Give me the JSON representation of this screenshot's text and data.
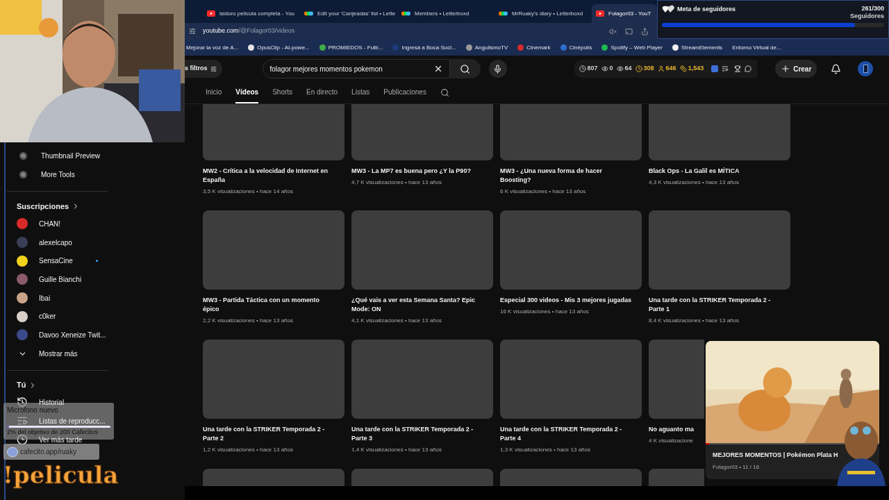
{
  "browser": {
    "tabs": [
      {
        "title": "isidoro pelicula completa - You",
        "kind": "youtube",
        "selected": false
      },
      {
        "title": "Edit your 'Canjeadas' list • Lette",
        "kind": "letterboxd",
        "selected": false
      },
      {
        "title": "Members • Letterboxd",
        "kind": "letterboxd",
        "selected": false
      },
      {
        "title": "MrRuaky's diary • Letterboxd",
        "kind": "letterboxd",
        "selected": false
      },
      {
        "title": "Folagor03 - YouT",
        "kind": "youtube",
        "selected": true
      }
    ],
    "url": {
      "host": "youtube.com",
      "path": "/@Folagor03/videos"
    },
    "bookmarks": [
      {
        "label": "Mejorar la voz de A..."
      },
      {
        "label": "OpusClip - AI-powe...",
        "color": "#e5e5e5"
      },
      {
        "label": "PROMIEDOS - Futb...",
        "color": "#3fae49"
      },
      {
        "label": "Ingresá a Boca Soci...",
        "color": "#1d3b7a"
      },
      {
        "label": "AngulismoTV",
        "color": "#9a9a9a"
      },
      {
        "label": "Cinemark",
        "color": "#d42a2a"
      },
      {
        "label": "Cinépolis",
        "color": "#2d6fd1"
      },
      {
        "label": "Spotify – Web Player",
        "color": "#1db954"
      },
      {
        "label": "StreamElements",
        "color": "#f0f0f0"
      },
      {
        "label": "Entorno Virtual de..."
      }
    ]
  },
  "follower_goal": {
    "title": "Meta de seguidores",
    "count": "261/300",
    "unit": "Seguidores",
    "level": 0.87
  },
  "header": {
    "filter_chip": "s filtros",
    "search": {
      "value": "folagor mejores momentos pokemon"
    },
    "stats": [
      {
        "value": "807",
        "kind": "clock",
        "color": "#d0d0d0"
      },
      {
        "value": "0",
        "kind": "eye",
        "color": "#d0d0d0"
      },
      {
        "value": "64",
        "kind": "eye",
        "color": "#d0d0d0"
      },
      {
        "value": "308",
        "kind": "clock",
        "color": "#e8b531"
      },
      {
        "value": "646",
        "kind": "person",
        "color": "#e8b531"
      },
      {
        "value": "1,543",
        "kind": "coin",
        "color": "#e8b531"
      }
    ],
    "create": "Crear"
  },
  "channel_tabs": [
    {
      "label": "Inicio",
      "selected": false
    },
    {
      "label": "Vídeos",
      "selected": true
    },
    {
      "label": "Shorts",
      "selected": false
    },
    {
      "label": "En directo",
      "selected": false
    },
    {
      "label": "Listas",
      "selected": false
    },
    {
      "label": "Publicaciones",
      "selected": false
    }
  ],
  "sidebar": {
    "tools": [
      "Thumbnail Preview",
      "More Tools"
    ],
    "subscriptions_title": "Suscripciones",
    "channels": [
      {
        "name": "CHAN!",
        "color": "#d92a2a",
        "new": false
      },
      {
        "name": "alexelcapo",
        "color": "#3b3f55",
        "new": false
      },
      {
        "name": "SensaCine",
        "color": "#f1d21c",
        "new": true
      },
      {
        "name": "Guille Bianchi",
        "color": "#8a5a6a",
        "new": false
      },
      {
        "name": "Ibai",
        "color": "#c9a48a",
        "new": false
      },
      {
        "name": "c0ker",
        "color": "#d8d0c8",
        "new": false
      },
      {
        "name": "Davoo Xeneize Twit...",
        "color": "#3a4a8a",
        "new": false
      }
    ],
    "show_more": "Mostrar más",
    "you_title": "Tú",
    "you_items": [
      {
        "label": "Historial",
        "kind": "history"
      },
      {
        "label": "Listas de reproducc...",
        "kind": "playlists"
      },
      {
        "label": "Ver más tarde",
        "kind": "later"
      }
    ]
  },
  "videos": [
    [
      {
        "kind": "video",
        "title": "MW2 - Crítica a la velocidad de Internet en España",
        "meta": "3,5 K visualizaciones • hace 14 años"
      },
      {
        "kind": "video",
        "title": "MW3 - La MP7 es buena pero ¿Y la P90?",
        "meta": "4,7 K visualizaciones • hace 13 años"
      },
      {
        "kind": "video",
        "title": "MW3 - ¿Una nueva forma de hacer Boosting?",
        "meta": "6 K visualizaciones • hace 13 años"
      },
      {
        "kind": "video",
        "title": "Black Ops - La Galil es MÍTICA",
        "meta": "4,3 K visualizaciones • hace 13 años"
      }
    ],
    [
      {
        "kind": "video",
        "title": "MW3 - Partida Táctica con un momento épico",
        "meta": "2,2 K visualizaciones • hace 13 años"
      },
      {
        "kind": "video",
        "title": "¿Qué vais a ver esta Semana Santa? Epic Mode: ON",
        "meta": "4,1 K visualizaciones • hace 13 años"
      },
      {
        "kind": "video",
        "title": "Especial 300 videos - Mis 3 mejores jugadas",
        "meta": "16 K visualizaciones • hace 13 años"
      },
      {
        "kind": "video",
        "title": "Una tarde con la STRIKER Temporada 2 - Parte 1",
        "meta": "8,4 K visualizaciones • hace 13 años"
      }
    ],
    [
      {
        "kind": "video",
        "title": "Una tarde con la STRIKER Temporada 2 - Parte 2",
        "meta": "1,2 K visualizaciones • hace 13 años"
      },
      {
        "kind": "video",
        "title": "Una tarde con la STRIKER Temporada 2 - Parte 3",
        "meta": "1,4 K visualizaciones • hace 13 años"
      },
      {
        "kind": "video",
        "title": "Una tarde con la STRIKER Temporada 2 - Parte 4",
        "meta": "1,3 K visualizaciones • hace 13 años"
      },
      {
        "kind": "video",
        "title": "No aguanto ma",
        "meta": "4 K visualizacione"
      }
    ],
    [
      {
        "kind": "thumbnail-only"
      },
      {
        "kind": "thumbnail-only"
      },
      {
        "kind": "thumbnail-only"
      },
      {
        "kind": "thumbnail-only"
      }
    ]
  ],
  "mini_player": {
    "title": "MEJORES MOMENTOS | Pokémon Plata H",
    "subtitle": "Folagor03 • 11 / 16",
    "level": 0.02
  },
  "donation_goal": {
    "title": "Microfono nuevo",
    "level": 0.02,
    "caption": "2% del objetivo de 200 Cafecitos",
    "link": "cafecito.app/ruaky"
  },
  "command": "!pelicula"
}
